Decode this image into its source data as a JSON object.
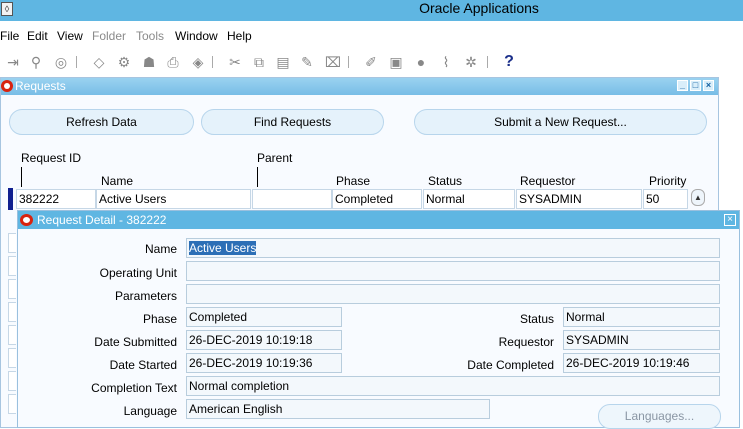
{
  "window": {
    "title": "Oracle Applications",
    "app_icon": "oracle-app-icon"
  },
  "menu": {
    "file": "File",
    "edit": "Edit",
    "view": "View",
    "folder": "Folder",
    "tools": "Tools",
    "window": "Window",
    "help": "Help"
  },
  "toolbar": {
    "help_glyph": "?"
  },
  "requests": {
    "title": "Requests",
    "refresh_label": "Refresh Data",
    "find_label": "Find Requests",
    "submit_label": "Submit a New Request...",
    "columns": {
      "request_id": "Request ID",
      "name": "Name",
      "parent": "Parent",
      "phase": "Phase",
      "status": "Status",
      "requestor": "Requestor",
      "priority": "Priority"
    },
    "rows": [
      {
        "request_id": "382222",
        "name": "Active Users",
        "parent": "",
        "phase": "Completed",
        "status": "Normal",
        "requestor": "SYSADMIN",
        "priority": "50"
      }
    ]
  },
  "detail": {
    "title": "Request Detail - 382222",
    "labels": {
      "name": "Name",
      "operating_unit": "Operating Unit",
      "parameters": "Parameters",
      "phase": "Phase",
      "status": "Status",
      "date_submitted": "Date Submitted",
      "requestor": "Requestor",
      "date_started": "Date Started",
      "date_completed": "Date Completed",
      "completion_text": "Completion Text",
      "language": "Language"
    },
    "values": {
      "name": "Active Users",
      "operating_unit": "",
      "parameters": "",
      "phase": "Completed",
      "status": "Normal",
      "date_submitted": "26-DEC-2019 10:19:18",
      "requestor": "SYSADMIN",
      "date_started": "26-DEC-2019 10:19:36",
      "date_completed": "26-DEC-2019 10:19:46",
      "completion_text": "Normal completion",
      "language": "American English"
    },
    "languages_button": "Languages..."
  },
  "colors": {
    "title_bar": "#5fb6e2",
    "selection": "#2c6fb6",
    "oracle_red": "#d9230f"
  }
}
